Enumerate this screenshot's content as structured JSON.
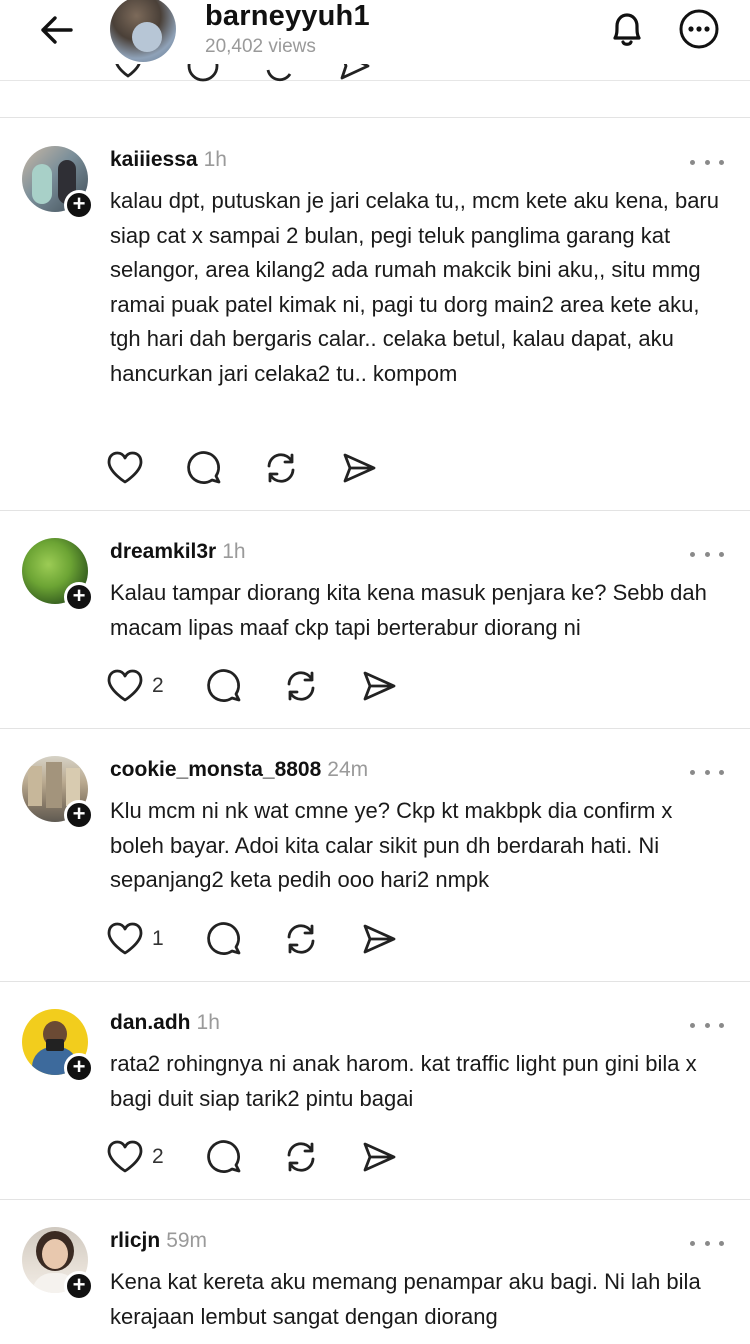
{
  "header": {
    "username": "barneyyuh1",
    "views": "20,402 views"
  },
  "posts": [
    {
      "username": "kaiiiessa",
      "time": "1h",
      "text": "kalau dpt, putuskan je jari celaka tu,, mcm kete aku kena, baru siap cat x sampai 2 bulan, pegi teluk panglima garang kat selangor, area kilang2 ada rumah makcik bini aku,, situ mmg ramai puak patel kimak ni, pagi tu dorg main2 area kete aku, tgh hari dah bergaris calar.. celaka betul, kalau dapat, aku hancurkan jari celaka2 tu.. kompom",
      "likes": ""
    },
    {
      "username": "dreamkil3r",
      "time": "1h",
      "text": "Kalau tampar diorang kita kena masuk penjara ke? Sebb dah macam lipas maaf ckp tapi berterabur diorang ni",
      "likes": "2"
    },
    {
      "username": "cookie_monsta_8808",
      "time": "24m",
      "text": "Klu mcm ni nk wat cmne ye? Ckp kt makbpk dia confirm x boleh bayar. Adoi kita calar sikit pun dh berdarah hati. Ni sepanjang2 keta pedih ooo hari2 nmpk",
      "likes": "1"
    },
    {
      "username": "dan.adh",
      "time": "1h",
      "text": "rata2 rohingnya ni anak harom. kat traffic light pun gini bila x bagi duit siap tarik2 pintu bagai",
      "likes": "2"
    },
    {
      "username": "rlicjn",
      "time": "59m",
      "text": "Kena kat kereta aku memang penampar aku bagi. Ni lah bila kerajaan lembut sangat dengan diorang",
      "likes": ""
    }
  ]
}
